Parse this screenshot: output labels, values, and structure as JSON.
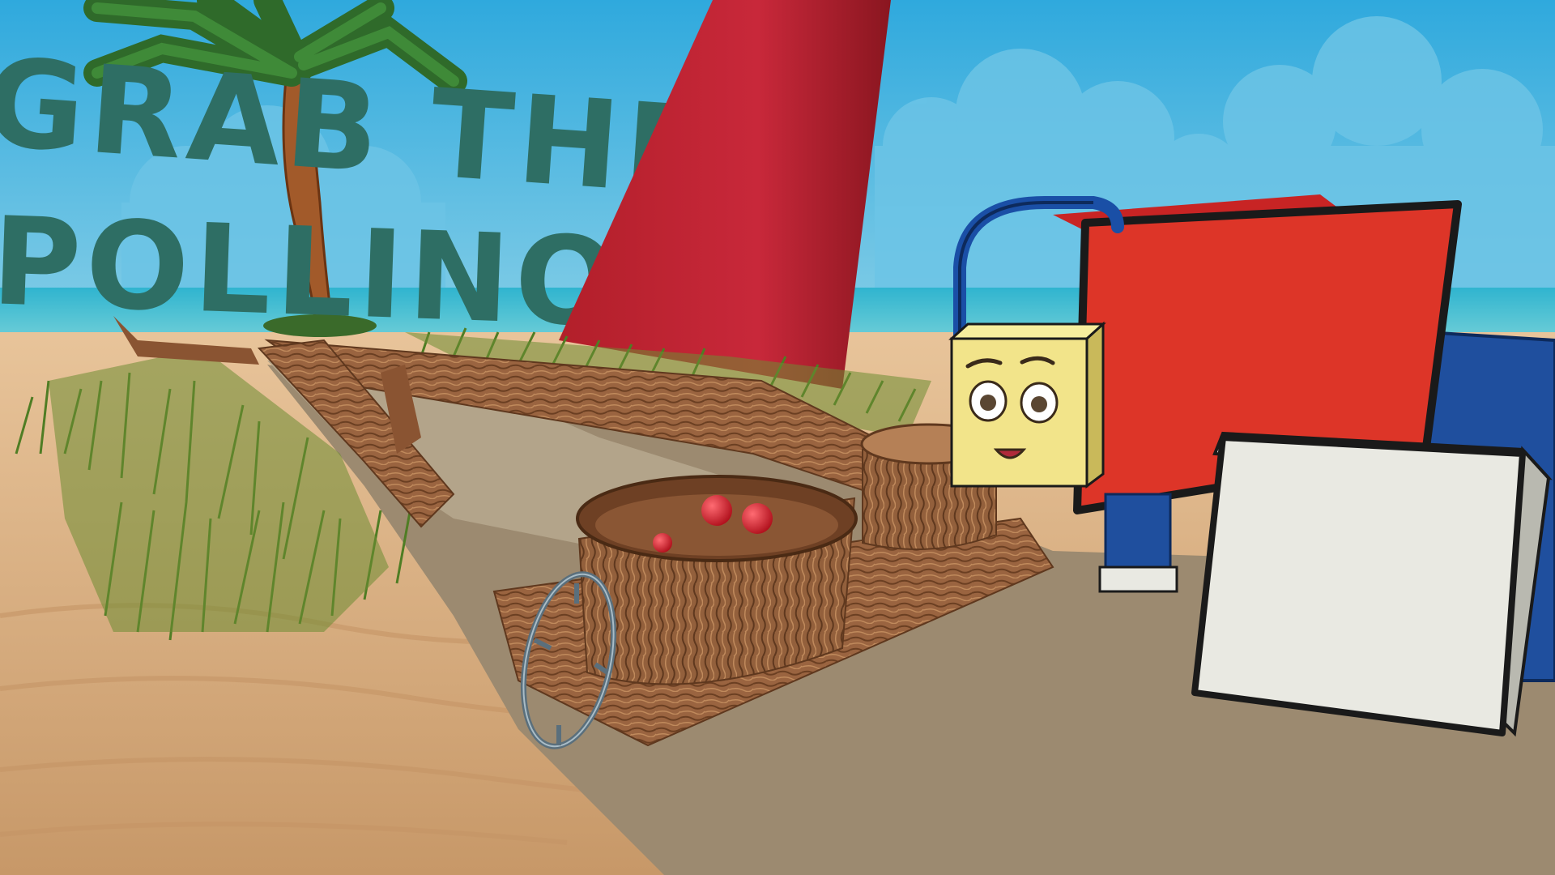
{
  "game": {
    "title_line_1": "GRAB THE",
    "title_line_2": "POLLINO"
  },
  "colors": {
    "sky": "#3fb3e0",
    "sea": "#3fb6cf",
    "sand": "#d9a878",
    "path": "#a89376",
    "title": "#2e6e64",
    "red_panel": "#d9302a",
    "blue_block": "#1f4f9e",
    "white_block": "#e9e9e2",
    "wood": "#9a6440",
    "pollen_ball": "#d92030",
    "character": "#f2e48a",
    "handle_ring": "#5a6f7c"
  },
  "scene_objects": [
    "palm-tree",
    "title-sign",
    "red-sail",
    "log-bridge",
    "wooden-bowl",
    "tree-stump",
    "pollen-balls",
    "grab-ring",
    "character-head",
    "red-panel",
    "blue-block",
    "white-block"
  ]
}
